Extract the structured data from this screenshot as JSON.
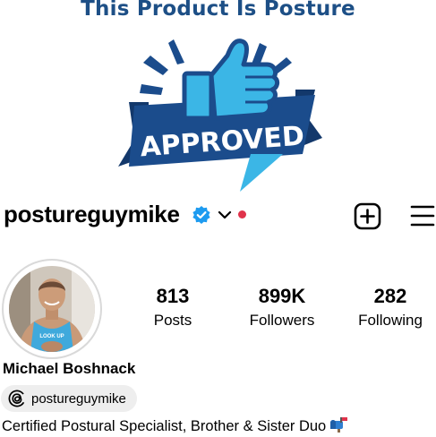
{
  "banner": {
    "title": "This Product Is Posture",
    "stamp_text": "APPROVED"
  },
  "profile": {
    "username": "postureguymike",
    "verified": true,
    "display_name": "Michael Boshnack",
    "avatar_shirt_text": "LOOK UP",
    "threads_handle": "postureguymike",
    "bio": "Certified Postural Specialist, Brother & Sister Duo",
    "bio_emoji": "mailbox-icon"
  },
  "stats": [
    {
      "count": "813",
      "label": "Posts"
    },
    {
      "count": "899K",
      "label": "Followers"
    },
    {
      "count": "282",
      "label": "Following"
    }
  ],
  "colors": {
    "banner_blue": "#1d4f86",
    "stamp_blue": "#1b4c8c",
    "thumb_blue": "#3bb6e6",
    "verified_blue": "#1d9bf0",
    "notification_red": "#e0334b",
    "pill_background": "#eeeeee"
  }
}
